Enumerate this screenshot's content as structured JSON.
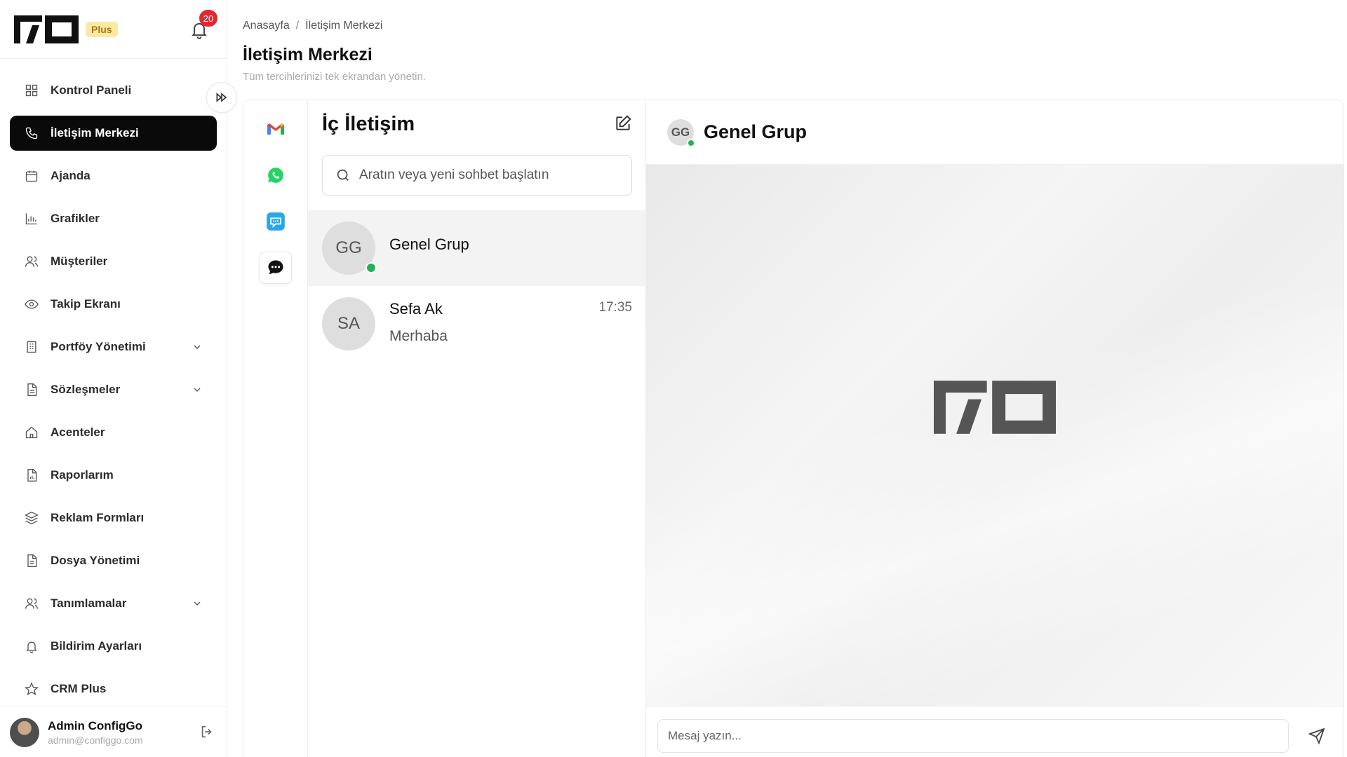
{
  "brand": {
    "badge": "Plus"
  },
  "notifications": {
    "count": "20"
  },
  "sidebar": {
    "items": [
      {
        "label": "Kontrol Paneli",
        "icon": "grid-icon",
        "active": false,
        "has_children": false
      },
      {
        "label": "İletişim Merkezi",
        "icon": "phone-icon",
        "active": true,
        "has_children": false
      },
      {
        "label": "Ajanda",
        "icon": "calendar-icon",
        "active": false,
        "has_children": false
      },
      {
        "label": "Grafikler",
        "icon": "bar-chart-icon",
        "active": false,
        "has_children": false
      },
      {
        "label": "Müşteriler",
        "icon": "users-icon",
        "active": false,
        "has_children": false
      },
      {
        "label": "Takip Ekranı",
        "icon": "eye-icon",
        "active": false,
        "has_children": false
      },
      {
        "label": "Portföy Yönetimi",
        "icon": "building-icon",
        "active": false,
        "has_children": true
      },
      {
        "label": "Sözleşmeler",
        "icon": "document-icon",
        "active": false,
        "has_children": true
      },
      {
        "label": "Acenteler",
        "icon": "home-icon",
        "active": false,
        "has_children": false
      },
      {
        "label": "Raporlarım",
        "icon": "report-icon",
        "active": false,
        "has_children": false
      },
      {
        "label": "Reklam Formları",
        "icon": "layers-icon",
        "active": false,
        "has_children": false
      },
      {
        "label": "Dosya Yönetimi",
        "icon": "file-icon",
        "active": false,
        "has_children": false
      },
      {
        "label": "Tanımlamalar",
        "icon": "users-icon",
        "active": false,
        "has_children": true
      },
      {
        "label": "Bildirim Ayarları",
        "icon": "bell-icon",
        "active": false,
        "has_children": false
      },
      {
        "label": "CRM Plus",
        "icon": "star-icon",
        "active": false,
        "has_children": false
      }
    ]
  },
  "user": {
    "name": "Admin ConfigGo",
    "email": "admin@configgo.com"
  },
  "header": {
    "breadcrumb": [
      "Anasayfa",
      "İletişim Merkezi"
    ],
    "title": "İletişim Merkezi",
    "subtitle": "Tüm tercihlerinizi tek ekrandan yönetin."
  },
  "channels": [
    {
      "name": "gmail-icon",
      "active": false
    },
    {
      "name": "whatsapp-icon",
      "active": false
    },
    {
      "name": "sms-icon",
      "active": false
    },
    {
      "name": "internal-chat-icon",
      "active": true
    }
  ],
  "chatlist": {
    "title": "İç İletişim",
    "search_placeholder": "Aratın veya yeni sohbet başlatın",
    "conversations": [
      {
        "initials": "GG",
        "name": "Genel Grup",
        "last": "",
        "time": "",
        "online": true,
        "active": true
      },
      {
        "initials": "SA",
        "name": "Sefa Ak",
        "last": "Merhaba",
        "time": "17:35",
        "online": false,
        "active": false
      }
    ]
  },
  "chat": {
    "initials": "GG",
    "title": "Genel Grup",
    "message_placeholder": "Mesaj yazın..."
  },
  "colors": {
    "accent": "#0a0a0a",
    "online": "#22b25a",
    "badge": "#e5262f",
    "plus_bg": "#fde9a6"
  }
}
